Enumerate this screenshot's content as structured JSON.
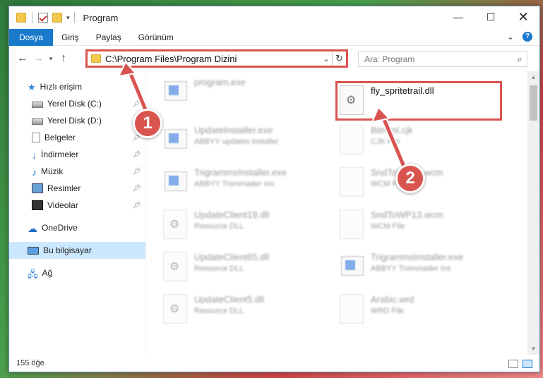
{
  "window": {
    "title": "Program",
    "controls": {
      "minimize": "—",
      "maximize": "☐",
      "close": "✕"
    }
  },
  "ribbon": {
    "tabs": [
      "Dosya",
      "Giriş",
      "Paylaş",
      "Görünüm"
    ]
  },
  "address": {
    "path": "C:\\Program Files\\Program Dizini"
  },
  "search": {
    "placeholder": "Ara: Program"
  },
  "sidebar": {
    "items": [
      {
        "label": "Hızlı erişim",
        "icon": "star-icon"
      },
      {
        "label": "Yerel Disk (C:)",
        "icon": "disk-icon"
      },
      {
        "label": "Yerel Disk (D:)",
        "icon": "disk-icon"
      },
      {
        "label": "Belgeler",
        "icon": "documents-icon"
      },
      {
        "label": "İndirmeler",
        "icon": "downloads-icon"
      },
      {
        "label": "Müzik",
        "icon": "music-icon"
      },
      {
        "label": "Resimler",
        "icon": "pictures-icon"
      },
      {
        "label": "Videolar",
        "icon": "videos-icon"
      },
      {
        "label": "OneDrive",
        "icon": "cloud-icon"
      },
      {
        "label": "Bu bilgisayar",
        "icon": "computer-icon"
      },
      {
        "label": "Ağ",
        "icon": "network-icon"
      }
    ]
  },
  "files": [
    {
      "name": "program.exe",
      "sub": "",
      "type": "exe"
    },
    {
      "name": "fly_spritetrail.dll",
      "sub": "",
      "type": "dll"
    },
    {
      "name": "UpdateInstaller.exe",
      "sub": "ABBYY updates installer",
      "type": "exe"
    },
    {
      "name": "Bitmml.cjk",
      "sub": "CJK File",
      "type": "doc"
    },
    {
      "name": "TrigrammsInstaller.exe",
      "sub": "ABBYY Trommader Ins",
      "type": "exe"
    },
    {
      "name": "SndToWP13.wcm",
      "sub": "WCM File",
      "type": "doc"
    },
    {
      "name": "UpdateClient19.dll",
      "sub": "Resource DLL",
      "type": "dll"
    },
    {
      "name": "SndToWP13.wcm",
      "sub": "WCM File",
      "type": "doc"
    },
    {
      "name": "UpdateClient65.dll",
      "sub": "Resource DLL",
      "type": "dll"
    },
    {
      "name": "TrigrammsInstaller.exe",
      "sub": "ABBYY Trommader Ins",
      "type": "exe"
    },
    {
      "name": "UpdateClient5.dll",
      "sub": "Resource DLL",
      "type": "dll"
    },
    {
      "name": "Arabic.wrd",
      "sub": "WRD File",
      "type": "doc"
    }
  ],
  "status": {
    "count": "155 öğe"
  },
  "annotations": {
    "badge1": "1",
    "badge2": "2",
    "color": "#d9534f"
  }
}
